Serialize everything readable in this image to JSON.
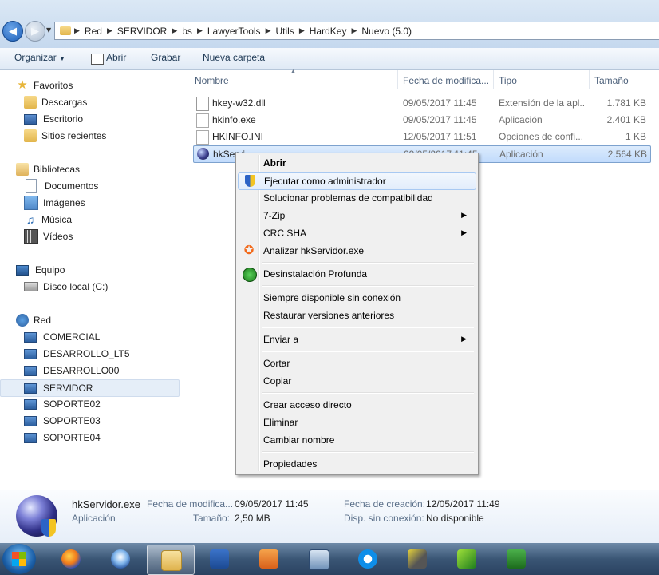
{
  "address": {
    "breadcrumbs": [
      "Red",
      "SERVIDOR",
      "bs",
      "LawyerTools",
      "Utils",
      "HardKey",
      "Nuevo (5.0)"
    ]
  },
  "toolbar": {
    "organize": "Organizar",
    "open": "Abrir",
    "burn": "Grabar",
    "new_folder": "Nueva carpeta"
  },
  "nav": {
    "favorites": "Favoritos",
    "downloads": "Descargas",
    "desktop": "Escritorio",
    "recent": "Sitios recientes",
    "libraries": "Bibliotecas",
    "documents": "Documentos",
    "images": "Imágenes",
    "music": "Música",
    "videos": "Vídeos",
    "computer": "Equipo",
    "local_disk": "Disco local (C:)",
    "network": "Red",
    "hosts": [
      "COMERCIAL",
      "DESARROLLO_LT5",
      "DESARROLLO00",
      "SERVIDOR",
      "SOPORTE02",
      "SOPORTE03",
      "SOPORTE04"
    ]
  },
  "columns": {
    "name": "Nombre",
    "date": "Fecha de modifica...",
    "type": "Tipo",
    "size": "Tamaño"
  },
  "files": [
    {
      "name": "hkey-w32.dll",
      "date": "09/05/2017 11:45",
      "type": "Extensión de la apl...",
      "size": "1.781 KB",
      "icon": "dll-icon"
    },
    {
      "name": "hkinfo.exe",
      "date": "09/05/2017 11:45",
      "type": "Aplicación",
      "size": "2.401 KB",
      "icon": "exe-icon"
    },
    {
      "name": "HKINFO.INI",
      "date": "12/05/2017 11:51",
      "type": "Opciones de confi...",
      "size": "1 KB",
      "icon": "ini-icon"
    },
    {
      "name": "hkServidor.exe",
      "date": "09/05/2017 11:45",
      "type": "Aplicación",
      "size": "2.564 KB",
      "icon": "globe-icon",
      "visible_name": "hkServi"
    }
  ],
  "context_menu": {
    "open": "Abrir",
    "run_as_admin": "Ejecutar como administrador",
    "troubleshoot": "Solucionar problemas de compatibilidad",
    "zip": "7-Zip",
    "crc": "CRC SHA",
    "scan": "Analizar hkServidor.exe",
    "uninstall": "Desinstalación Profunda",
    "offline": "Siempre disponible sin conexión",
    "restore": "Restaurar versiones anteriores",
    "send_to": "Enviar a",
    "cut": "Cortar",
    "copy": "Copiar",
    "shortcut": "Crear acceso directo",
    "delete": "Eliminar",
    "rename": "Cambiar nombre",
    "properties": "Propiedades"
  },
  "details": {
    "filename": "hkServidor.exe",
    "filetype": "Aplicación",
    "modified_label": "Fecha de modifica...",
    "modified_value": "09/05/2017 11:45",
    "size_label": "Tamaño:",
    "size_value": "2,50 MB",
    "created_label": "Fecha de creación:",
    "created_value": "12/05/2017 11:49",
    "offline_label": "Disp. sin conexión:",
    "offline_value": "No disponible"
  },
  "colors": {
    "selection": "#c1dbfc",
    "selection_border": "#7da2ce",
    "toolbar_text": "#1e3955"
  }
}
